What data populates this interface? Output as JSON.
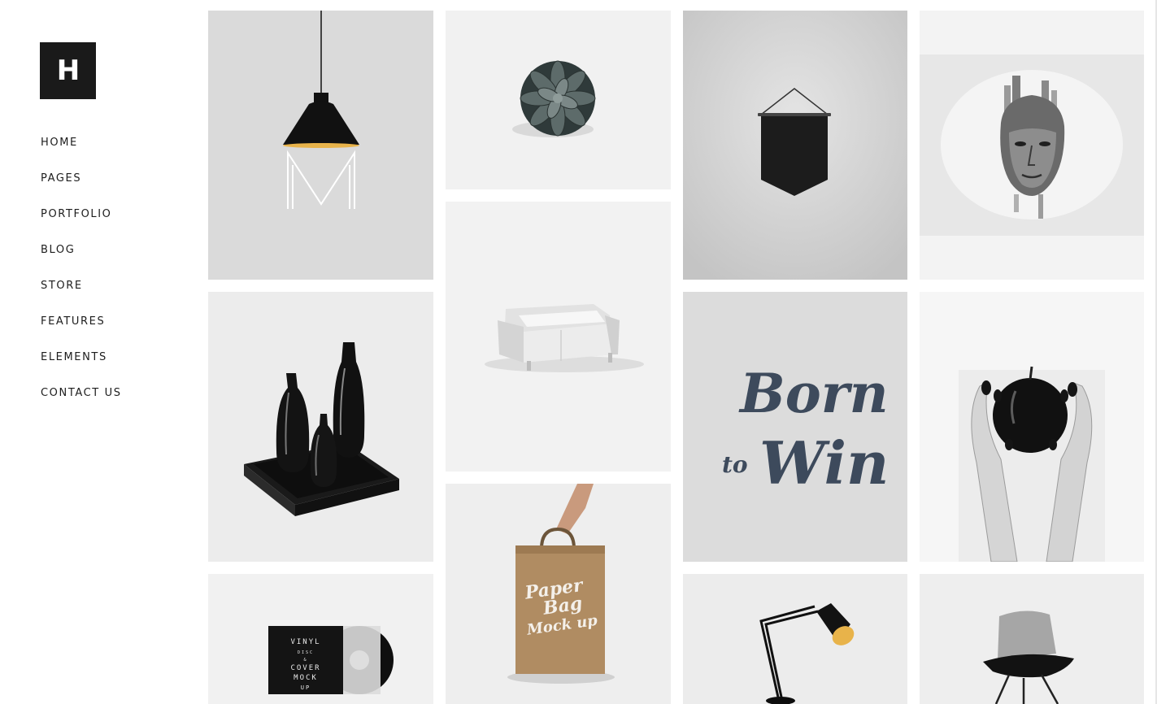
{
  "brand": {
    "logo_letter": "H"
  },
  "nav": {
    "items": [
      {
        "label": "HOME"
      },
      {
        "label": "PAGES"
      },
      {
        "label": "PORTFOLIO"
      },
      {
        "label": "BLOG"
      },
      {
        "label": "STORE"
      },
      {
        "label": "FEATURES"
      },
      {
        "label": "ELEMENTS"
      },
      {
        "label": "CONTACT US"
      }
    ]
  },
  "portfolio": {
    "items": [
      {
        "subject": "pendant lamp",
        "overlay_text": "M"
      },
      {
        "subject": "succulent plant"
      },
      {
        "subject": "black pennant"
      },
      {
        "subject": "double exposure portrait"
      },
      {
        "subject": "black vases on tray"
      },
      {
        "subject": "white sofa"
      },
      {
        "subject": "lettering",
        "overlay_text": [
          "Born",
          "to",
          "Win"
        ]
      },
      {
        "subject": "hands holding black apple"
      },
      {
        "subject": "vinyl record mockup",
        "overlay_text": [
          "VINYL",
          "DISC",
          "&",
          "COVER",
          "MOCK",
          "UP"
        ]
      },
      {
        "subject": "paper bag",
        "overlay_text": [
          "Paper",
          "Bag",
          "Mock up"
        ]
      },
      {
        "subject": "desk lamp"
      },
      {
        "subject": "lounge chair"
      }
    ]
  },
  "colors": {
    "logo_bg": "#1a1a1a",
    "tile_light": "#f1f1f1",
    "tile_mid": "#d8d8d8",
    "lettering": "#3d4a5c",
    "lamp_glow": "#e8b34a",
    "kraft": "#b08c62"
  }
}
